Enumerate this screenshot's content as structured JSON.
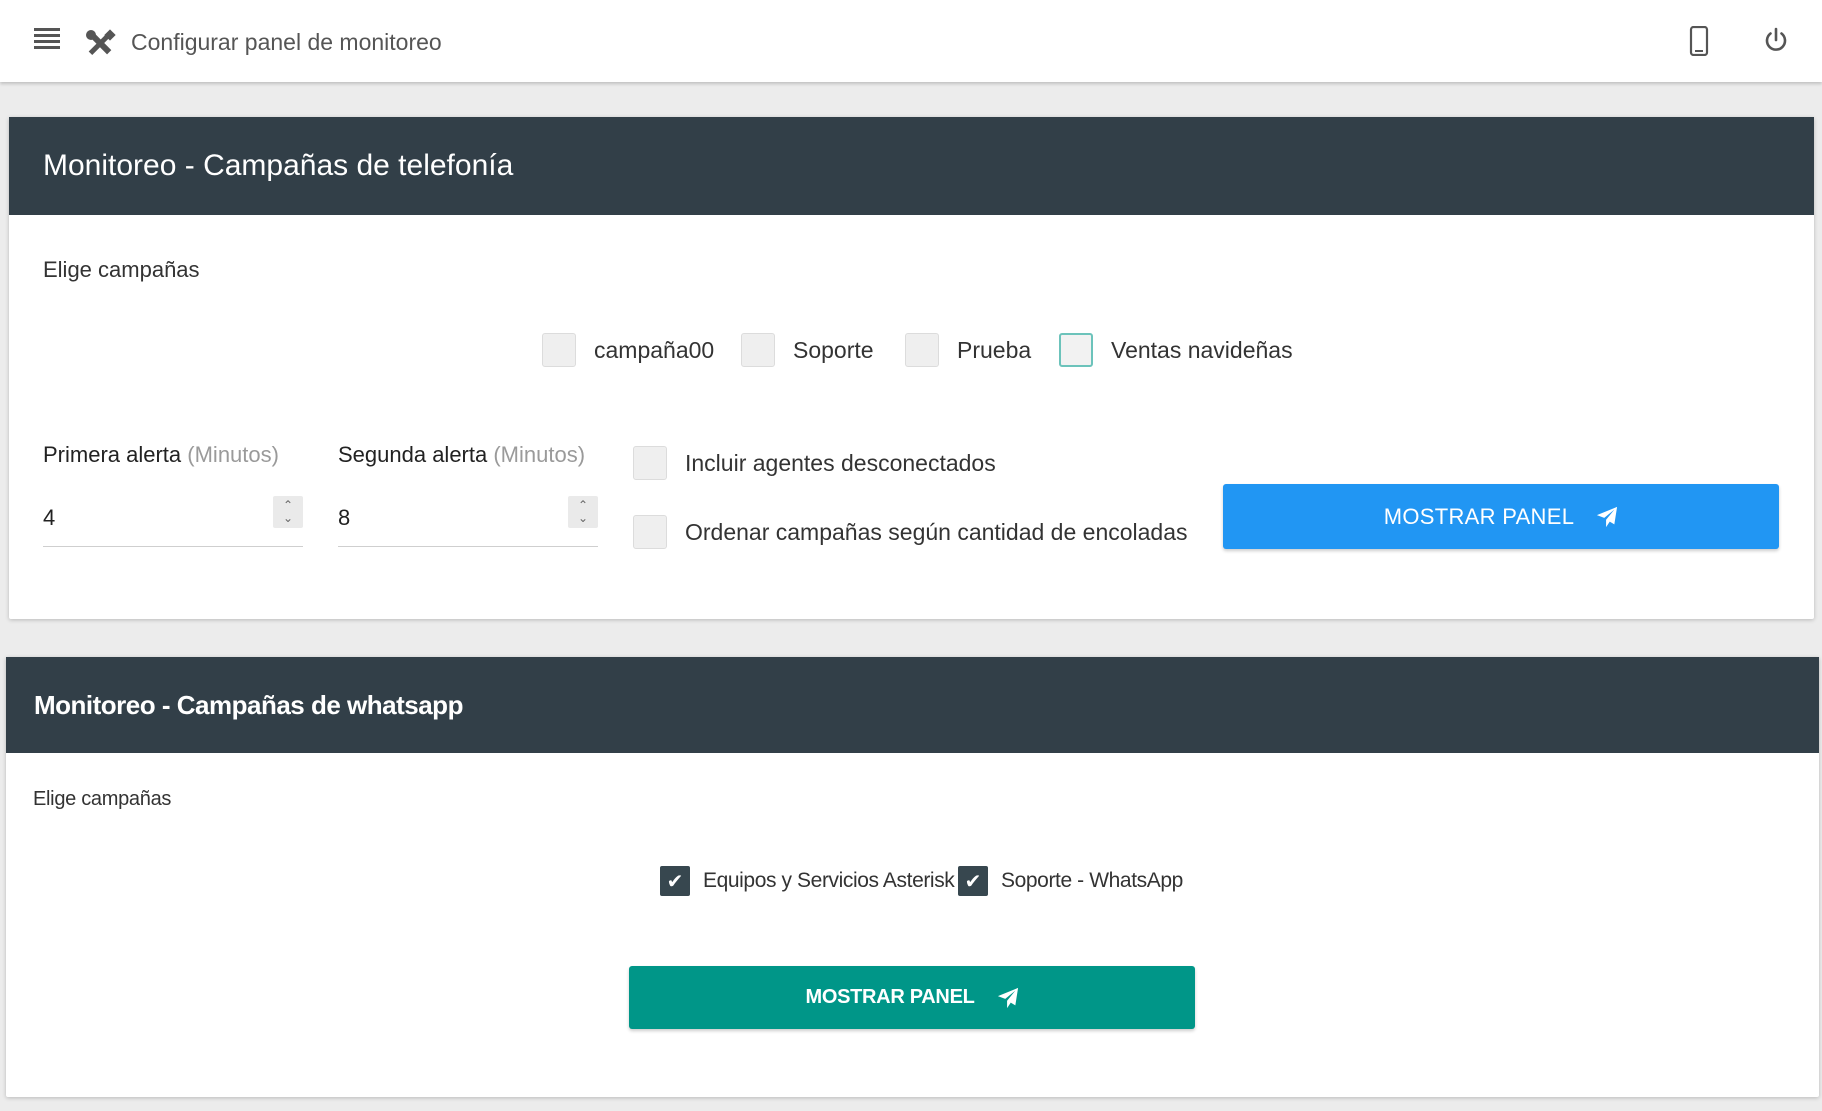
{
  "topbar": {
    "title": "Configurar panel de monitoreo",
    "icons": [
      "menu-icon",
      "tools-icon",
      "phone-icon",
      "power-icon"
    ]
  },
  "telefonia": {
    "title": "Monitoreo - Campañas de telefonía",
    "choose_label": "Elige campañas",
    "campaigns": [
      {
        "label": "campaña00",
        "checked": false
      },
      {
        "label": "Soporte",
        "checked": false
      },
      {
        "label": "Prueba",
        "checked": false
      },
      {
        "label": "Ventas navideñas",
        "checked": false,
        "focused": true
      }
    ],
    "first_alert": {
      "label": "Primera alerta",
      "unit": "(Minutos)",
      "value": "4"
    },
    "second_alert": {
      "label": "Segunda alerta",
      "unit": "(Minutos)",
      "value": "8"
    },
    "options": [
      {
        "label": "Incluir agentes desconectados",
        "checked": false
      },
      {
        "label": "Ordenar campañas según cantidad de encoladas",
        "checked": false
      }
    ],
    "button_label": "MOSTRAR PANEL"
  },
  "whatsapp": {
    "title": "Monitoreo - Campañas de whatsapp",
    "choose_label": "Elige campañas",
    "campaigns": [
      {
        "label": "Equipos y Servicios Asterisk",
        "checked": true
      },
      {
        "label": "Soporte - WhatsApp",
        "checked": true
      }
    ],
    "button_label": "MOSTRAR PANEL"
  },
  "colors": {
    "header_dark": "#323f48",
    "primary_blue": "#2196f3",
    "teal": "#009688",
    "checkbox_checked": "#37474f"
  }
}
